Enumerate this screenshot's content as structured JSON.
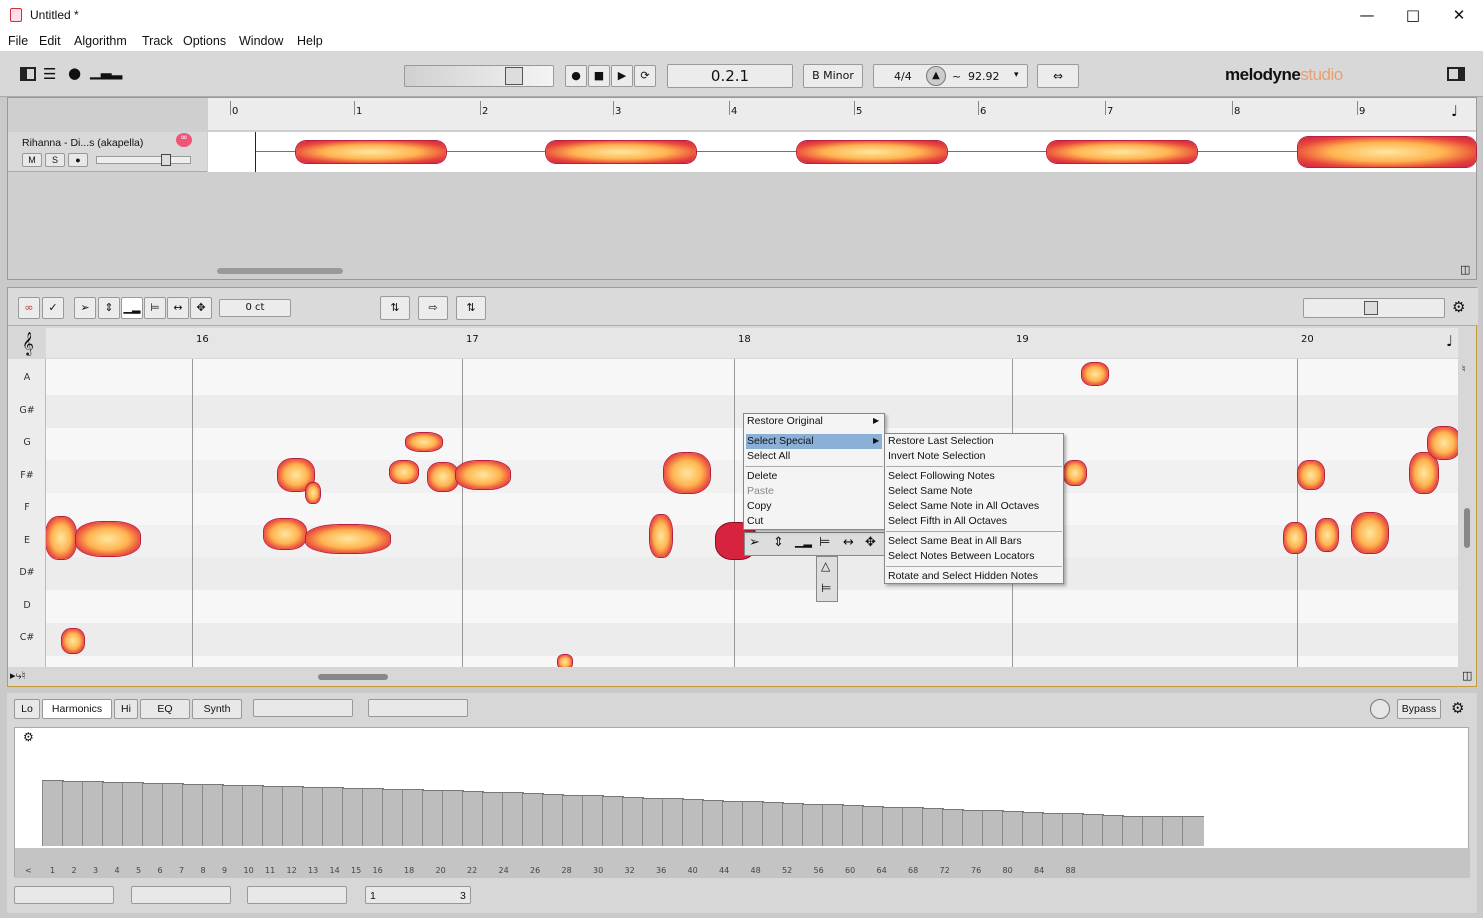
{
  "window": {
    "title": "Untitled *"
  },
  "menu": [
    "File",
    "Edit",
    "Algorithm",
    "Track",
    "Options",
    "Window",
    "Help"
  ],
  "transport": {
    "position": "0.2.1",
    "key": "B Minor",
    "meter": "4/4",
    "tempo_prefix": "~",
    "tempo": "92.92"
  },
  "brand": {
    "name": "melodyne",
    "edition": "studio"
  },
  "overview": {
    "track_name": "Rihanna - Di...s (akapella)",
    "mute": "M",
    "solo": "S",
    "ruler": [
      "0",
      "1",
      "2",
      "3",
      "4",
      "5",
      "6",
      "7",
      "8",
      "9"
    ]
  },
  "editor": {
    "cents_field": "0 ct",
    "ruler": [
      "16",
      "17",
      "18",
      "19",
      "20"
    ],
    "pitches": [
      "A",
      "G#",
      "G",
      "F#",
      "F",
      "E",
      "D#",
      "D",
      "C#"
    ]
  },
  "context_menu": {
    "items": [
      "Restore Original",
      "Select Special",
      "Select All",
      "Delete",
      "Paste",
      "Copy",
      "Cut"
    ],
    "submenu": [
      "Restore Last Selection",
      "Invert Note Selection",
      "Select Following Notes",
      "Select Same Note",
      "Select Same Note in All Octaves",
      "Select Fifth in All Octaves",
      "Select Same Beat in All Bars",
      "Select Notes Between Locators",
      "Rotate and Select Hidden Notes"
    ]
  },
  "sound_editor": {
    "tabs": [
      "Lo",
      "Harmonics",
      "Hi",
      "EQ",
      "Synth"
    ],
    "bypass": "Bypass",
    "harmonic_labels": [
      "<",
      "1",
      "2",
      "3",
      "4",
      "5",
      "6",
      "7",
      "8",
      "9",
      "10",
      "11",
      "12",
      "13",
      "14",
      "15",
      "16",
      "18",
      "20",
      "22",
      "24",
      "26",
      "28",
      "30",
      "32",
      "36",
      "40",
      "44",
      "48",
      "52",
      "56",
      "60",
      "64",
      "68",
      "72",
      "76",
      "80",
      "84",
      "88"
    ],
    "ratio_left": "1",
    "ratio_right": "3"
  },
  "colors": {
    "accent": "#e8762c",
    "selected": "#d8233e",
    "editor_border": "#c79a3a"
  }
}
